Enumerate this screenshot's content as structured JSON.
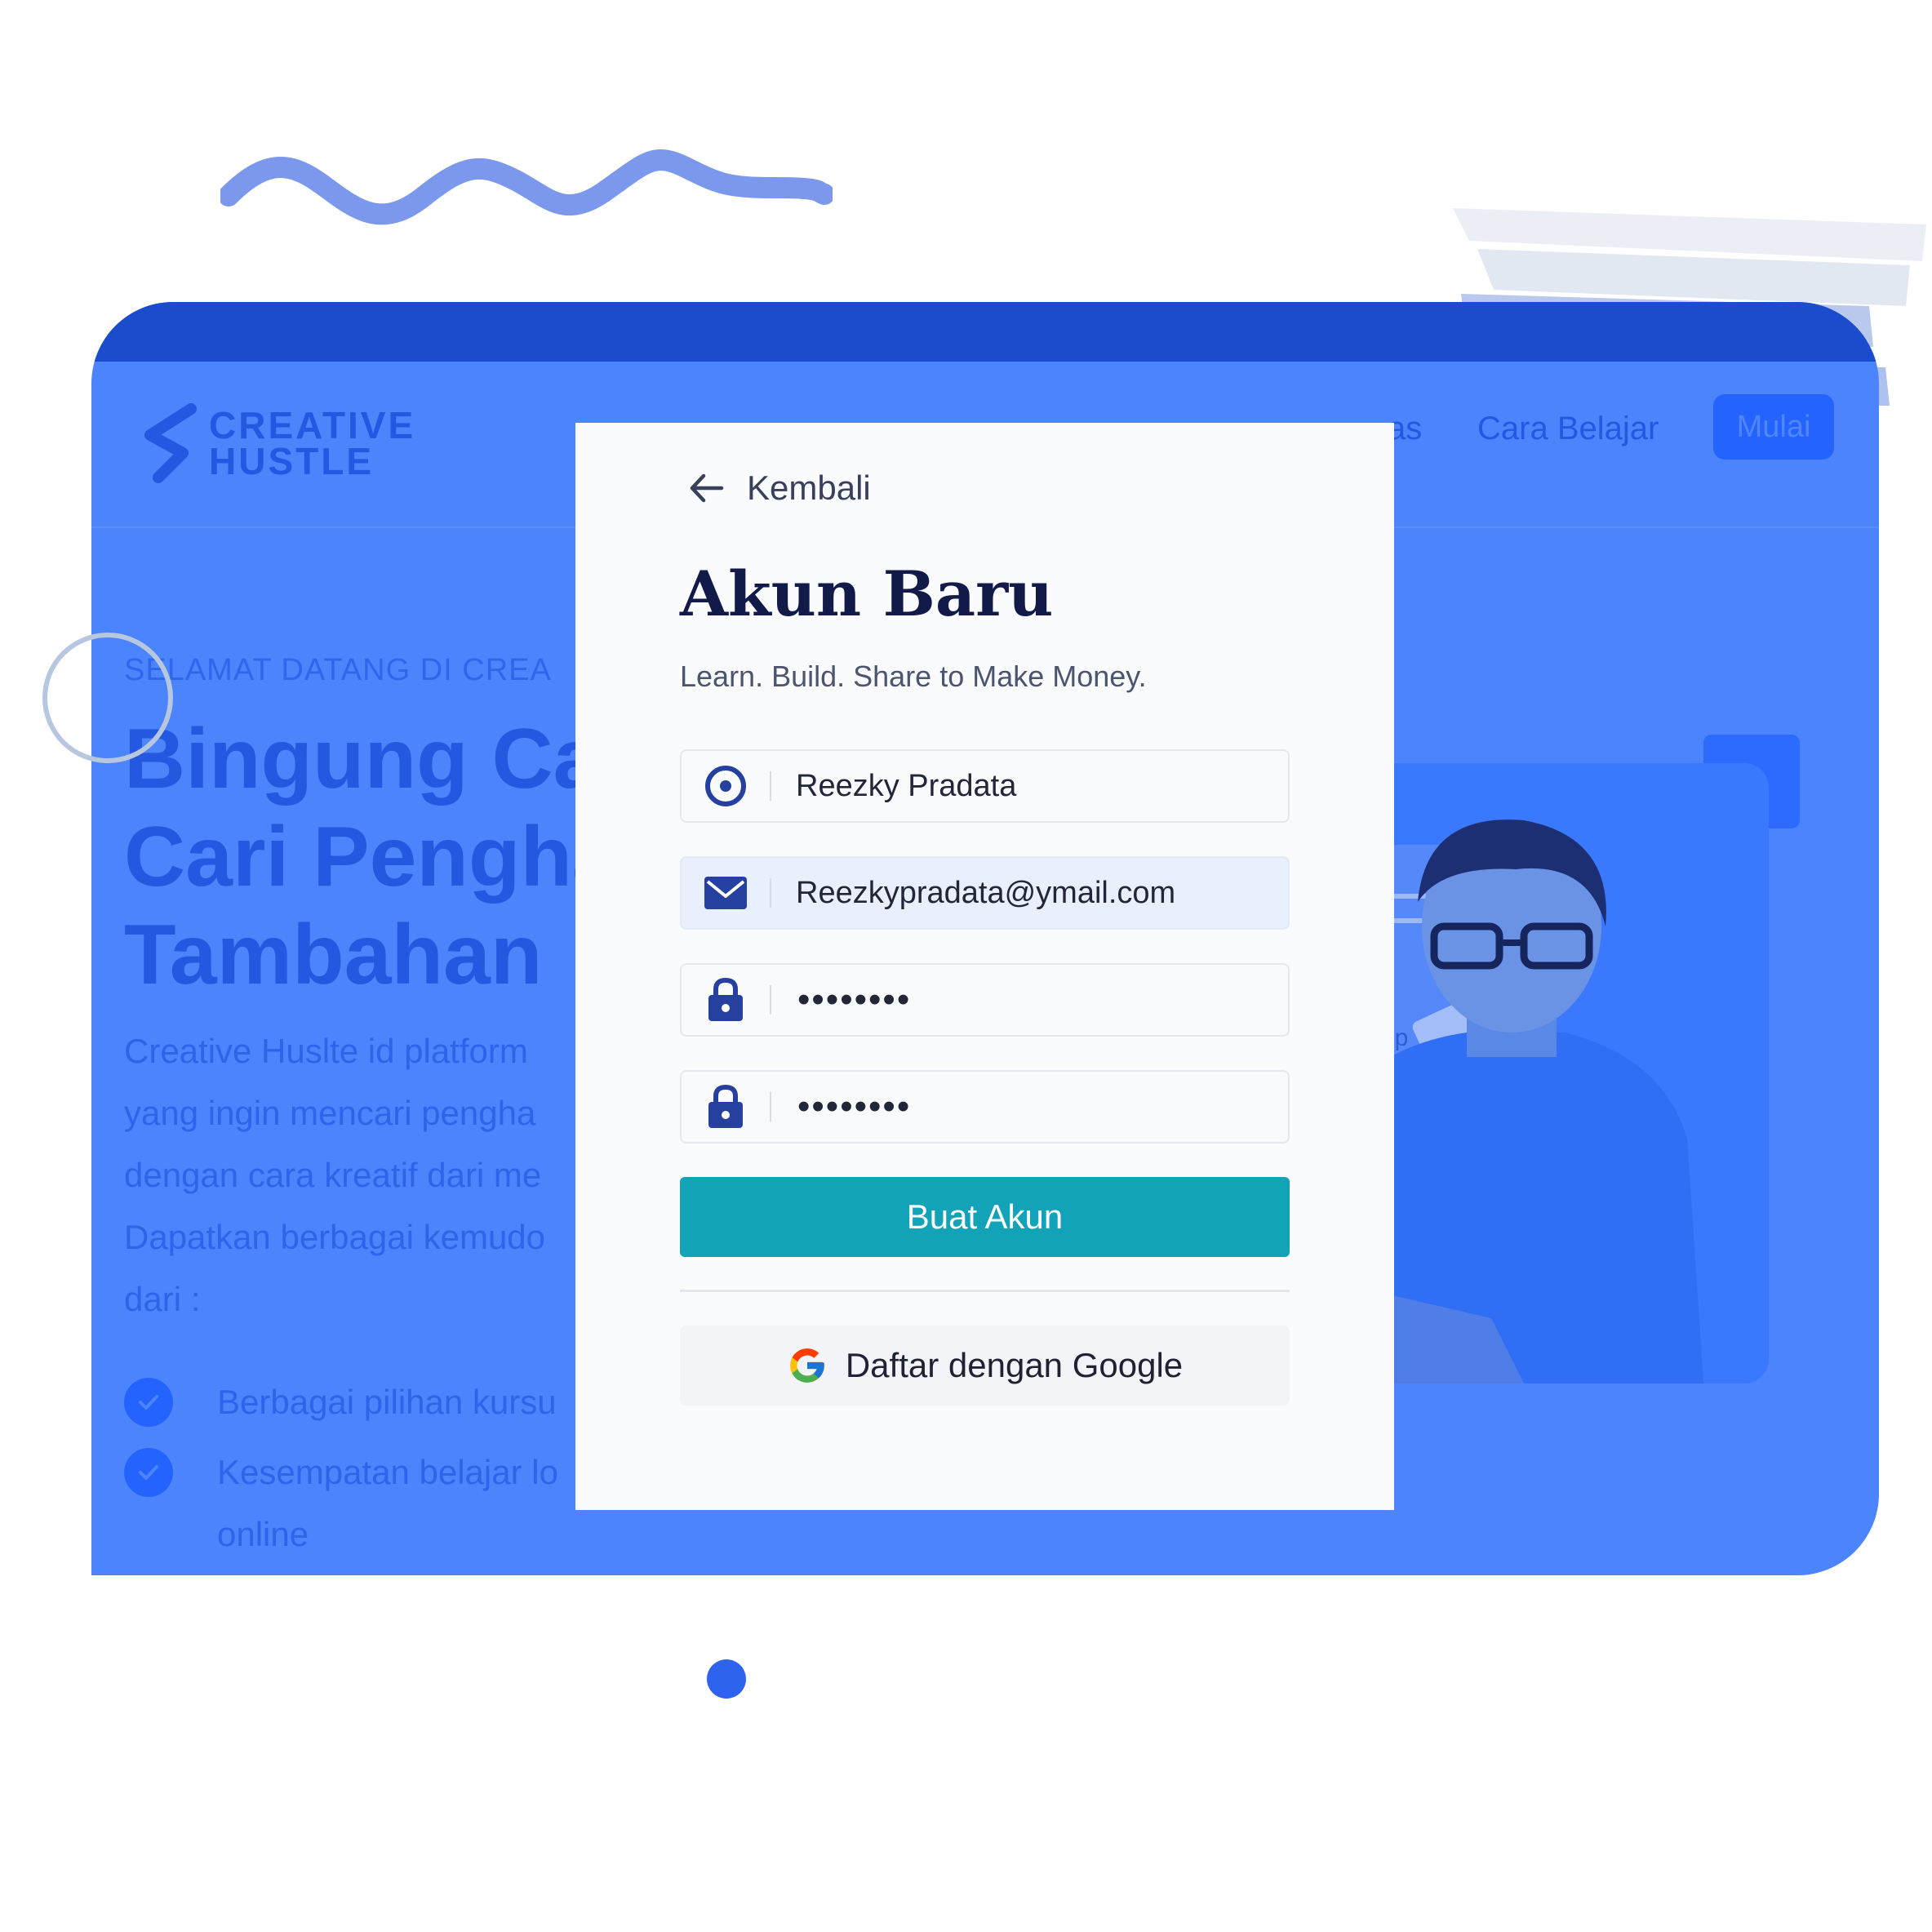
{
  "brand": {
    "line1": "CREATIVE",
    "line2": "HUSTLE"
  },
  "nav": {
    "partial_link": "as",
    "cara_belajar": "Cara Belajar",
    "mulai": "Mulai"
  },
  "hero": {
    "eyebrow": "SELAMAT DATANG DI CREA",
    "title_lines": [
      "Bingung Ca",
      "Cari Pengha",
      "Tambahan"
    ],
    "description_lines": [
      "Creative Huslte id platform",
      "yang ingin mencari pengha",
      "dengan cara kreatif dari me",
      "Dapatkan berbagai kemudo",
      "dari :"
    ],
    "checks": [
      {
        "lines": [
          "Berbagai pilihan kursu"
        ]
      },
      {
        "lines": [
          "Kesempatan belajar lo",
          "online"
        ]
      }
    ],
    "photo_label": "up"
  },
  "modal": {
    "back_label": "Kembali",
    "title": "Akun Baru",
    "subtitle": "Learn. Build. Share to Make Money.",
    "fields": {
      "name": "Reezky Pradata",
      "email": "Reezkypradata@ymail.com",
      "password": "••••••••",
      "confirm_password": "••••••••"
    },
    "submit_label": "Buat Akun",
    "google_label": "Daftar dengan Google"
  },
  "icons": {
    "back": "arrow-left-icon",
    "name": "user-circle-icon",
    "email": "mail-icon",
    "password": "lock-icon",
    "google": "google-icon",
    "check": "check-icon"
  },
  "colors": {
    "primary": "#4b84fd",
    "dark_primary": "#1b4ccc",
    "accent": "#13a3b8",
    "title": "#121a4a"
  }
}
